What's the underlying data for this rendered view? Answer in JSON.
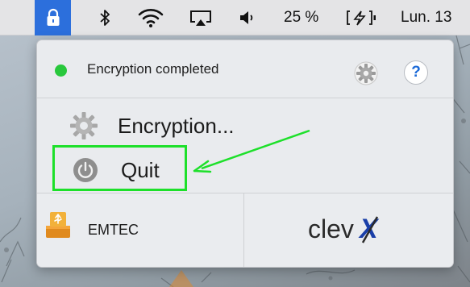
{
  "menubar": {
    "lock_icon": "lock-icon",
    "battery_percent": "25 %",
    "clock": "Lun. 13"
  },
  "popover": {
    "status": {
      "text": "Encryption completed",
      "color": "#28c83c"
    },
    "menu": {
      "encrypt_label": "Encryption...",
      "quit_label": "Quit"
    },
    "device": {
      "name": "EMTEC"
    },
    "logo_text": "clevX",
    "help_label": "?"
  },
  "annotation": {
    "color": "#1de02a"
  }
}
